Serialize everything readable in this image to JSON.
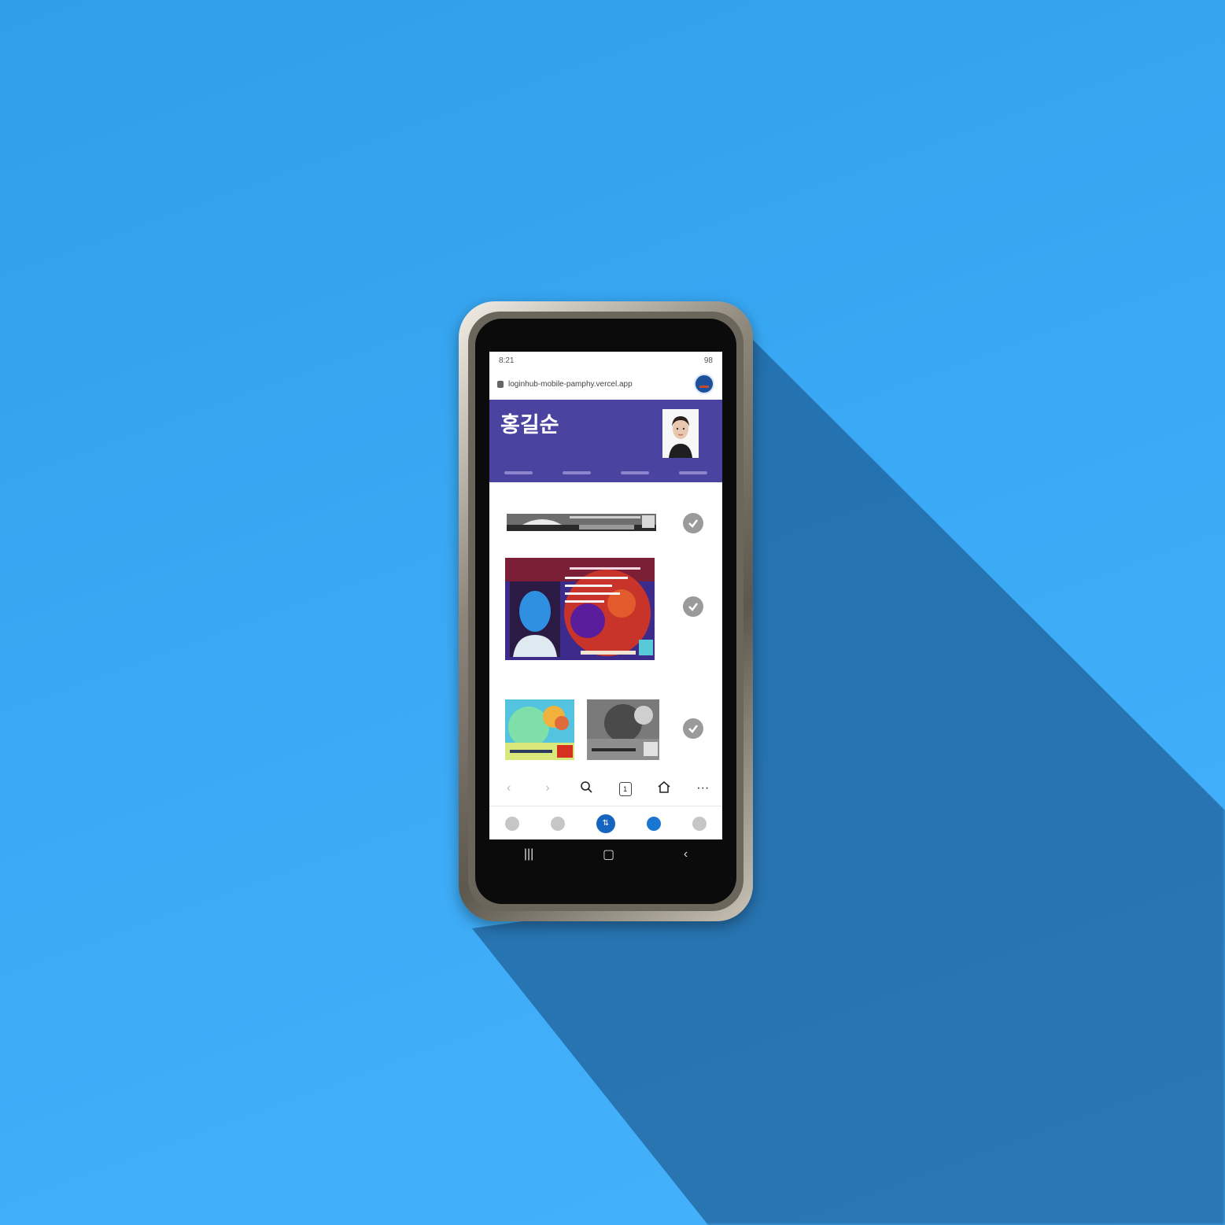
{
  "status_bar": {
    "time": "8:21",
    "right_text": "98"
  },
  "url_bar": {
    "url": "loginhub-mobile-pamphy.vercel.app"
  },
  "profile": {
    "name": "홍길순"
  },
  "header": {
    "color": "#4a43a0",
    "tabs": [
      "",
      "",
      "",
      ""
    ]
  },
  "id_cards": [
    {
      "variant": "grayscale-cropped",
      "verified": true
    },
    {
      "variant": "thermal-color",
      "verified": true
    },
    {
      "variant": "pair-color-and-grayscale",
      "verified": true
    }
  ],
  "browser_toolbar": {
    "items": [
      "back-icon",
      "forward-icon",
      "search-icon",
      "tabs-icon",
      "home-icon",
      "more-icon"
    ],
    "tab_count": "1",
    "more": "···"
  },
  "app_nav": {
    "items": [
      "wallet-icon",
      "history-icon",
      "transfer-icon",
      "explore-icon",
      "settings-icon"
    ],
    "active_label": "⇅"
  },
  "android_nav": {
    "recents": "|||",
    "home": "▢",
    "back": "‹"
  }
}
